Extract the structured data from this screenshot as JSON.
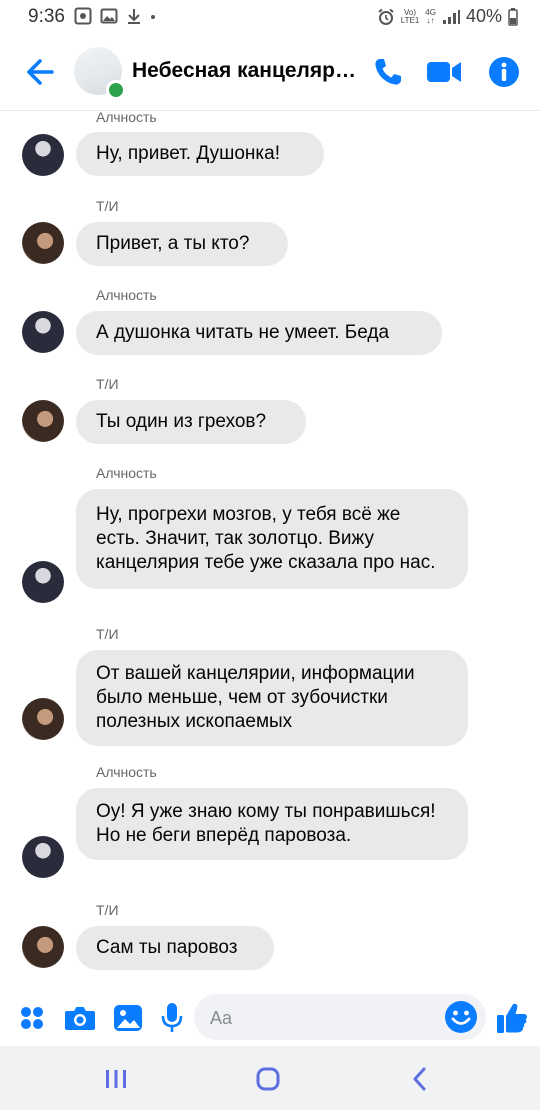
{
  "status_bar": {
    "time": "9:36",
    "network_top": "Vo)",
    "network_bottom": "LTE1",
    "network_type": "4G",
    "battery": "40%"
  },
  "header": {
    "title": "Небесная канцелярия",
    "icons": [
      "back-arrow-icon",
      "phone-icon",
      "video-camera-icon",
      "info-icon"
    ],
    "accent_color": "#0a7cff"
  },
  "messages": [
    {
      "sender": "Алчность",
      "text": "Ну, привет. Душонка!"
    },
    {
      "sender": "Т/И",
      "text": "Привет, а ты кто?"
    },
    {
      "sender": "Алчность",
      "text": "А душонка читать не умеет. Беда"
    },
    {
      "sender": "Т/И",
      "text": "Ты один из грехов?"
    },
    {
      "sender": "Алчность",
      "text": "Ну, прогрехи мозгов, у тебя всё же есть. Значит, так золотцо. Вижу канцелярия тебе уже сказала про нас."
    },
    {
      "sender": "Т/И",
      "text": "От вашей канцелярии, информации было меньше, чем от зубочистки полезных ископаемых"
    },
    {
      "sender": "Алчность",
      "text": "Оу! Я уже знаю кому ты понравишься! Но не беги вперёд паровоза."
    },
    {
      "sender": "Т/И",
      "text": "Сам ты паровоз"
    }
  ],
  "composer": {
    "placeholder": "Aa",
    "icons": [
      "apps-grid-icon",
      "camera-icon",
      "gallery-icon",
      "microphone-icon",
      "emoji-icon",
      "thumbs-up-icon"
    ]
  },
  "nav_bar": {
    "icons": [
      "recent-apps-icon",
      "home-icon",
      "back-icon"
    ]
  }
}
